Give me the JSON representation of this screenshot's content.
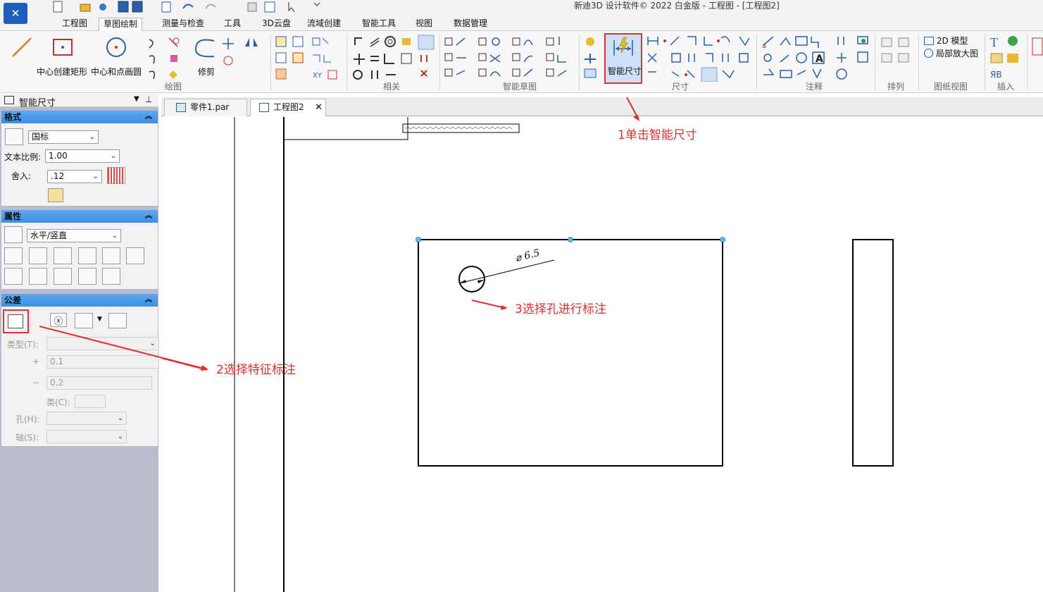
{
  "window": {
    "title": "新迪3D 设计软件© 2022 白金版 - 工程图 - [工程图2]"
  },
  "menu_tabs": [
    "工程图",
    "草图绘制",
    "测量与检查",
    "工具",
    "3D云盘",
    "流域创建",
    "智能工具",
    "视图",
    "数据管理"
  ],
  "ribbon": {
    "draw_buttons": {
      "rect_center": "中心创建矩形",
      "circle_center": "中心和点画圆",
      "trim": "修剪"
    },
    "groups": [
      "绘图",
      "相关",
      "智能草图",
      "尺寸",
      "注释",
      "排列",
      "图纸视图",
      "插入"
    ],
    "smart_dimension_label": "智能尺寸",
    "view_items": {
      "model_2d": "2D 模型",
      "detail": "局部放大图"
    }
  },
  "sidebar": {
    "title": "智能尺寸",
    "format": {
      "header": "格式",
      "standard": "国标",
      "text_scale_label": "文本比例:",
      "text_scale": "1.00",
      "round_label": "舍入:",
      "round_value": ".12"
    },
    "properties": {
      "header": "属性",
      "orientation": "水平/竖直"
    },
    "tolerance": {
      "header": "公差",
      "type_label": "类型(T):",
      "plus_sign": "+",
      "plus_value": "0.1",
      "minus_sign": "−",
      "minus_value": "0.2",
      "class_label": "类(C):",
      "hole_label": "孔(H):",
      "shaft_label": "轴(S):"
    }
  },
  "doc_tabs": [
    {
      "label": "零件1.par",
      "active": false
    },
    {
      "label": "工程图2",
      "active": true
    }
  ],
  "drawing": {
    "dimension_text": "⌀ 6.5"
  },
  "annotations": {
    "step1": "1单击智能尺寸",
    "step2": "2选择特征标注",
    "step3": "3选择孔进行标注"
  },
  "colors": {
    "annotation": "#e32f2f",
    "panel_header": "#4a9cee",
    "sidebar_bg": "#b9bccd"
  }
}
